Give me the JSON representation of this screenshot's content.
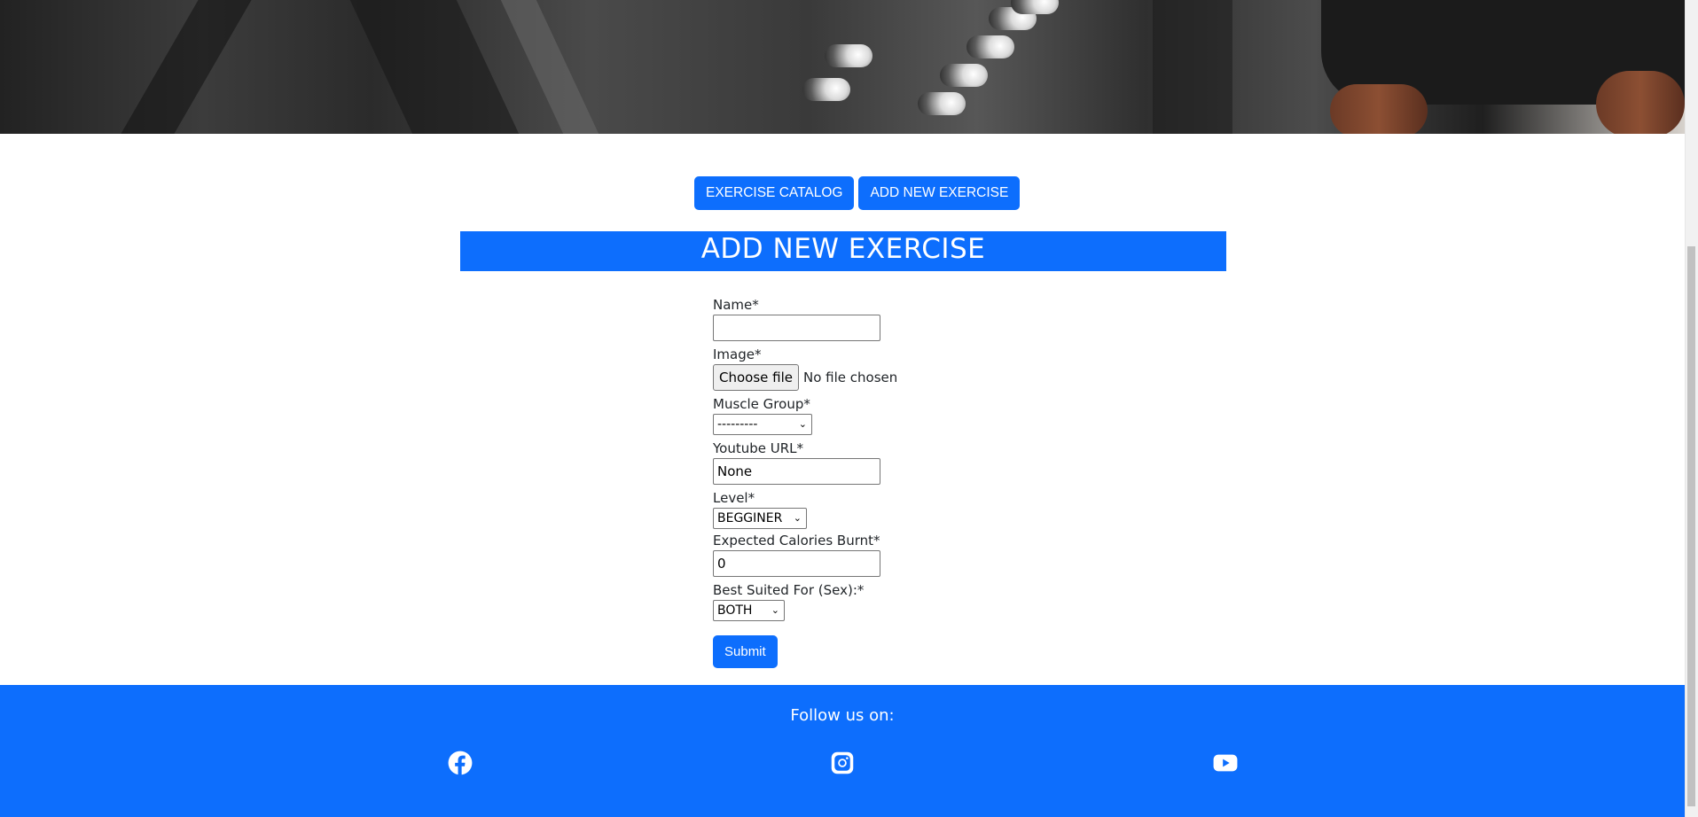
{
  "nav": {
    "catalog_label": "EXERCISE CATALOG",
    "add_label": "ADD NEW EXERCISE"
  },
  "page_title": "ADD NEW EXERCISE",
  "form": {
    "name_label": "Name*",
    "name_value": "",
    "image_label": "Image*",
    "file_button": "Choose file",
    "file_status": "No file chosen",
    "muscle_label": "Muscle Group*",
    "muscle_value": "---------",
    "youtube_label": "Youtube URL*",
    "youtube_value": "None",
    "level_label": "Level*",
    "level_value": "BEGGINER",
    "calories_label": "Expected Calories Burnt*",
    "calories_value": "0",
    "sex_label": "Best Suited For (Sex):*",
    "sex_value": "BOTH",
    "submit_label": "Submit"
  },
  "footer": {
    "follow_text": "Follow us on:",
    "icons": [
      "facebook-icon",
      "instagram-icon",
      "youtube-icon"
    ]
  },
  "colors": {
    "primary": "#0d6efd",
    "white": "#ffffff"
  }
}
